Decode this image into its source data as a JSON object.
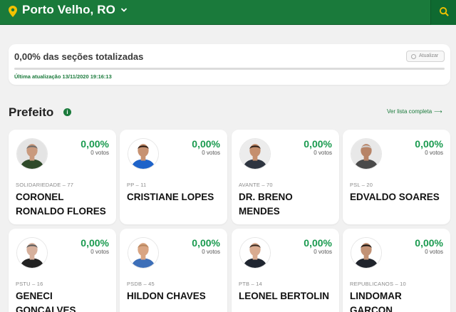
{
  "header": {
    "city": "Porto Velho, RO",
    "pin_icon": "map-pin-icon",
    "search_icon": "search-icon"
  },
  "status": {
    "sections_text": "0,00% das seções totalizadas",
    "progress_percent": 0,
    "refresh_label": "Atualizar",
    "updated_text": "Última atualização 13/11/2020 19:16:13"
  },
  "section": {
    "title": "Prefeito",
    "see_all": "Ver lista completa"
  },
  "colors": {
    "brand": "#1a7a3b",
    "percent": "#1a9a4f"
  },
  "candidates": [
    {
      "percent": "0,00%",
      "votes": "0 votos",
      "party": "SOLIDARIEDADE – 77",
      "name": "CORONEL RONALDO FLORES"
    },
    {
      "percent": "0,00%",
      "votes": "0 votos",
      "party": "PP – 11",
      "name": "CRISTIANE LOPES"
    },
    {
      "percent": "0,00%",
      "votes": "0 votos",
      "party": "AVANTE – 70",
      "name": "DR. BRENO MENDES"
    },
    {
      "percent": "0,00%",
      "votes": "0 votos",
      "party": "PSL – 20",
      "name": "EDVALDO SOARES"
    },
    {
      "percent": "0,00%",
      "votes": "0 votos",
      "party": "PSTU – 16",
      "name": "GENECI GONCALVES"
    },
    {
      "percent": "0,00%",
      "votes": "0 votos",
      "party": "PSDB – 45",
      "name": "HILDON CHAVES"
    },
    {
      "percent": "0,00%",
      "votes": "0 votos",
      "party": "PTB – 14",
      "name": "LEONEL BERTOLIN"
    },
    {
      "percent": "0,00%",
      "votes": "0 votos",
      "party": "REPUBLICANOS – 10",
      "name": "LINDOMAR GARCON"
    }
  ]
}
